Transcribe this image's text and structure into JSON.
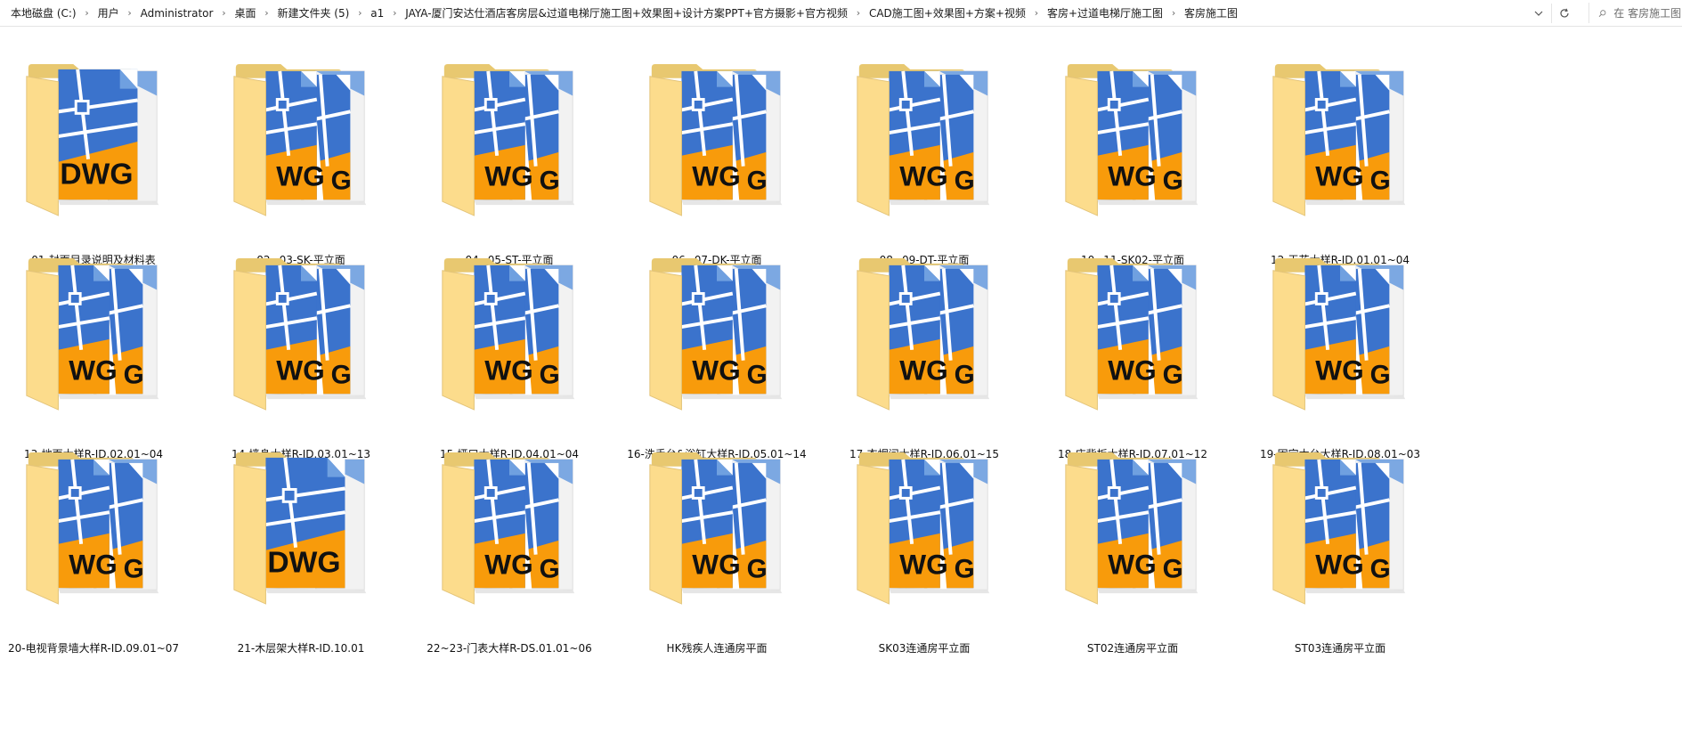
{
  "breadcrumb": [
    "本地磁盘 (C:)",
    "用户",
    "Administrator",
    "桌面",
    "新建文件夹 (5)",
    "a1",
    "JAYA-厦门安达仕酒店客房层&过道电梯厅施工图+效果图+设计方案PPT+官方摄影+官方视频",
    "CAD施工图+效果图+方案+视频",
    "客房+过道电梯厅施工图",
    "客房施工图"
  ],
  "search": {
    "placeholder": "在 客房施工图 中搜索"
  },
  "icons": {
    "folder": "dwg-folder-icon",
    "dropdown": "chevron-down-icon",
    "refresh": "refresh-icon",
    "search": "search-icon"
  },
  "colors": {
    "folder_back": "#E8C870",
    "folder_front": "#FCDC8C",
    "page_blue": "#3B73CC",
    "page_orange": "#F89B0B",
    "page_light_blue": "#6FA0E0"
  },
  "items": [
    {
      "name": "01-封面目录说明及材料表",
      "variant": "single"
    },
    {
      "name": "02~03-SK-平立面",
      "variant": "double"
    },
    {
      "name": "04~05-ST-平立面",
      "variant": "double"
    },
    {
      "name": "06~07-DK-平立面",
      "variant": "double"
    },
    {
      "name": "08~09-DT-平立面",
      "variant": "double"
    },
    {
      "name": "10~11-SK02-平立面",
      "variant": "double"
    },
    {
      "name": "12-天花大样R-ID.01.01~04",
      "variant": "double"
    },
    {
      "name": "13-地面大样R-ID.02.01~04",
      "variant": "double"
    },
    {
      "name": "14-墙身大样R-ID.03.01~13",
      "variant": "double"
    },
    {
      "name": "15-垭口大样R-ID.04.01~04",
      "variant": "double"
    },
    {
      "name": "16-洗手台&浴缸大样R-ID.05.01~14",
      "variant": "double"
    },
    {
      "name": "17-衣帽间大样R-ID.06.01~15",
      "variant": "double"
    },
    {
      "name": "18-床背板大样R-ID.07.01~12",
      "variant": "double"
    },
    {
      "name": "19-固定木台大样R-ID.08.01~03",
      "variant": "double"
    },
    {
      "name": "20-电视背景墙大样R-ID.09.01~07",
      "variant": "double"
    },
    {
      "name": "21-木层架大样R-ID.10.01",
      "variant": "single"
    },
    {
      "name": "22~23-门表大样R-DS.01.01~06",
      "variant": "double"
    },
    {
      "name": "HK残疾人连通房平面",
      "variant": "double"
    },
    {
      "name": "SK03连通房平立面",
      "variant": "double"
    },
    {
      "name": "ST02连通房平立面",
      "variant": "double"
    },
    {
      "name": "ST03连通房平立面",
      "variant": "double"
    }
  ]
}
